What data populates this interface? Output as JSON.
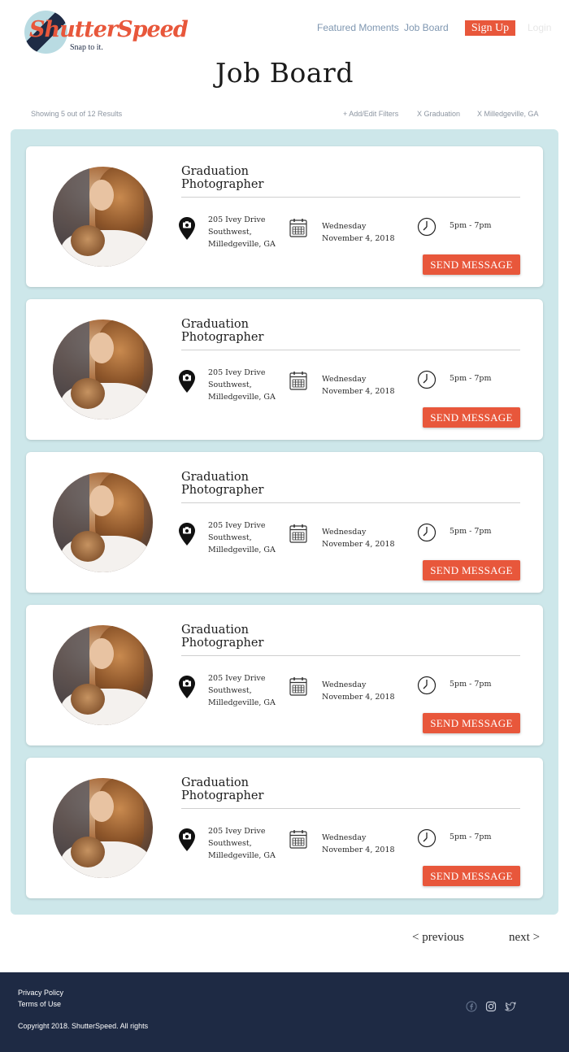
{
  "brand": {
    "name": "ShutterSpeed",
    "tagline": "Snap to it."
  },
  "nav": {
    "featured": "Featured Moments",
    "job_board": "Job Board",
    "signup": "Sign Up",
    "login": "Login"
  },
  "page_title": "Job Board",
  "filters": {
    "results": "Showing 5 out of 12 Results",
    "add": "+ Add/Edit Filters",
    "chips": [
      "X Graduation",
      "X Milledgeville, GA"
    ]
  },
  "cards": [
    {
      "title_line1": "Graduation",
      "title_line2": "Photographer",
      "addr1": "205 Ivey Drive",
      "addr2": "Southwest,",
      "addr3": "Milledgeville, GA",
      "day": "Wednesday",
      "date": "November 4, 2018",
      "time": "5pm - 7pm",
      "button": "SEND MESSAGE"
    },
    {
      "title_line1": "Graduation",
      "title_line2": "Photographer",
      "addr1": "205 Ivey Drive",
      "addr2": "Southwest,",
      "addr3": "Milledgeville, GA",
      "day": "Wednesday",
      "date": "November 4, 2018",
      "time": "5pm - 7pm",
      "button": "SEND MESSAGE"
    },
    {
      "title_line1": "Graduation",
      "title_line2": "Photographer",
      "addr1": "205 Ivey Drive",
      "addr2": "Southwest,",
      "addr3": "Milledgeville, GA",
      "day": "Wednesday",
      "date": "November 4, 2018",
      "time": "5pm - 7pm",
      "button": "SEND MESSAGE"
    },
    {
      "title_line1": "Graduation",
      "title_line2": "Photographer",
      "addr1": "205 Ivey Drive",
      "addr2": "Southwest,",
      "addr3": "Milledgeville, GA",
      "day": "Wednesday",
      "date": "November 4, 2018",
      "time": "5pm - 7pm",
      "button": "SEND MESSAGE"
    },
    {
      "title_line1": "Graduation",
      "title_line2": "Photographer",
      "addr1": "205 Ivey Drive",
      "addr2": "Southwest,",
      "addr3": "Milledgeville, GA",
      "day": "Wednesday",
      "date": "November 4, 2018",
      "time": "5pm - 7pm",
      "button": "SEND MESSAGE"
    }
  ],
  "pagination": {
    "previous": "< previous",
    "next": "next >"
  },
  "footer": {
    "privacy": "Privacy Policy",
    "terms": "Terms of Use",
    "copyright": "Copyright 2018. ShutterSpeed. All rights",
    "social_icons": [
      "facebook-icon",
      "instagram-icon",
      "twitter-icon"
    ]
  },
  "colors": {
    "accent": "#e8573b",
    "panel": "#cde7ea",
    "footer": "#1e2a44",
    "nav": "#7f97b1"
  }
}
